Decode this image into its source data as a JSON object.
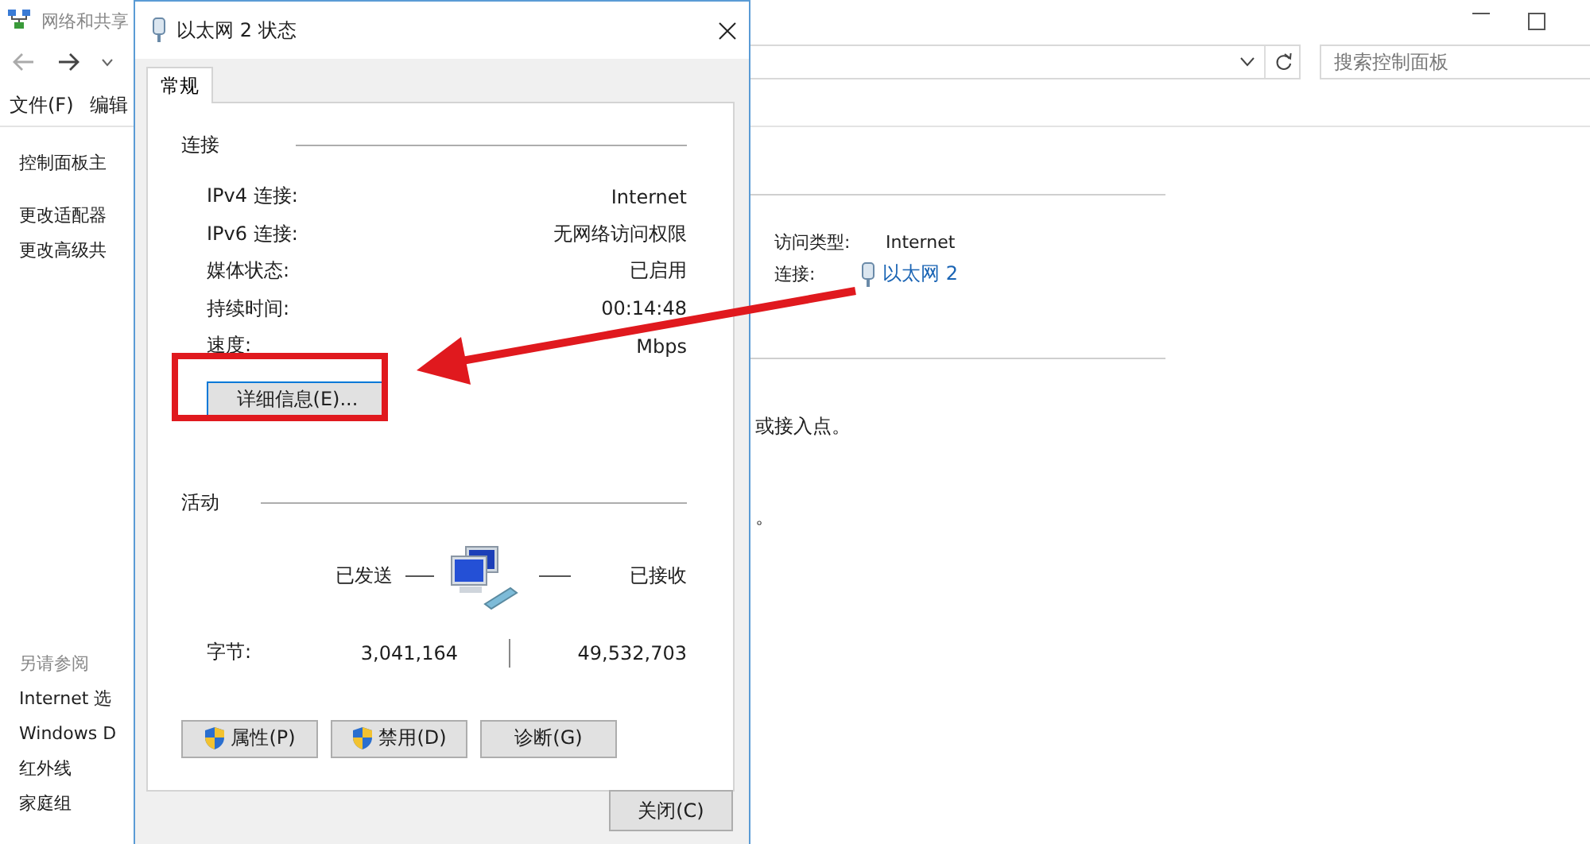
{
  "background_window": {
    "title": "网络和共享",
    "search": {
      "placeholder": "搜索控制面板"
    },
    "menu": [
      "文件(F)",
      "编辑"
    ],
    "sidebar": {
      "items": [
        "控制面板主",
        "更改适配器",
        "更改高级共"
      ],
      "see_also_heading": "另请参阅",
      "see_also": [
        "Internet 选",
        "Windows D",
        "红外线",
        "家庭组"
      ]
    },
    "network": {
      "access_type_label": "访问类型:",
      "access_type": "Internet",
      "connection_label": "连接:",
      "connection": "以太网 2"
    },
    "text_fragments": [
      "或接入点。",
      "。"
    ]
  },
  "dialog": {
    "title": "以太网 2 状态",
    "tabs": [
      {
        "label": "常规",
        "selected": true
      }
    ],
    "connection_group": {
      "title": "连接",
      "rows": [
        {
          "label": "IPv4 连接:",
          "value": "Internet"
        },
        {
          "label": "IPv6 连接:",
          "value": "无网络访问权限"
        },
        {
          "label": "媒体状态:",
          "value": "已启用"
        },
        {
          "label": "持续时间:",
          "value": "00:14:48"
        },
        {
          "label": "速度:",
          "value": "Mbps"
        }
      ],
      "details_button": "详细信息(E)..."
    },
    "activity_group": {
      "title": "活动",
      "sent": "已发送",
      "received": "已接收",
      "bytes_label": "字节:",
      "bytes_sent": "3,041,164",
      "bytes_received": "49,532,703"
    },
    "buttons": [
      {
        "label": "属性(P)",
        "shield": true
      },
      {
        "label": "禁用(D)",
        "shield": true
      },
      {
        "label": "诊断(G)",
        "shield": false
      }
    ],
    "close_button": "关闭(C)"
  }
}
